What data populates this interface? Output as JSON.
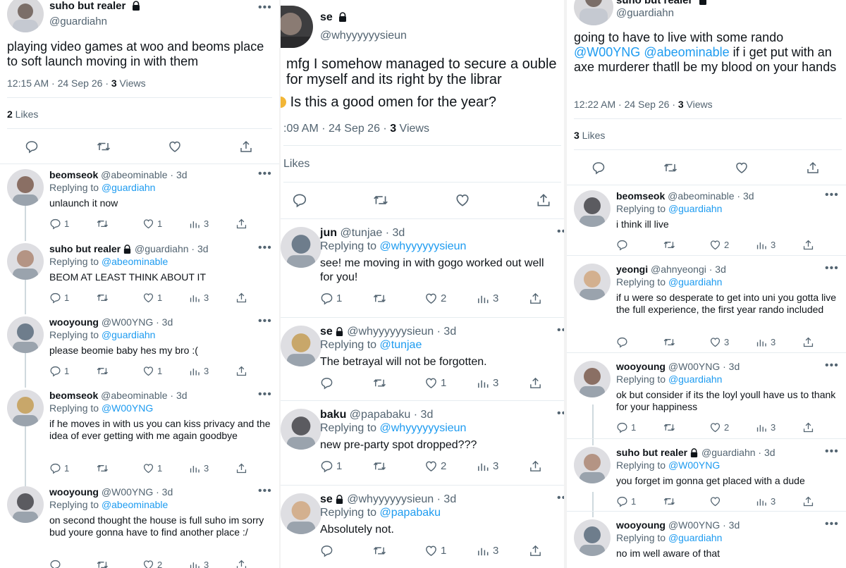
{
  "left": {
    "main": {
      "name": "suho but realer",
      "handle": "@guardiahn",
      "text": "playing video games at woo and beoms place to soft launch moving in with them",
      "time": "12:15 AM · 24 Sep 26 · ",
      "views_count": "3",
      "views_label": " Views",
      "likes_count": "2",
      "likes_label": " Likes"
    },
    "replies": [
      {
        "name": "beomseok",
        "meta": "@abeominable · 3d",
        "replying": "Replying to ",
        "to": "@guardiahn",
        "text": "unlaunch it now",
        "replies": "1",
        "likes": "1",
        "views": "3"
      },
      {
        "name": "suho but realer",
        "meta": "@guardiahn · 3d",
        "replying": "Replying to ",
        "to": "@abeominable",
        "text": "BEOM AT LEAST THINK ABOUT IT",
        "replies": "1",
        "likes": "1",
        "views": "3"
      },
      {
        "name": "wooyoung",
        "meta": "@W00YNG · 3d",
        "replying": "Replying to ",
        "to": "@guardiahn",
        "text": "please beomie baby hes my bro :(",
        "replies": "1",
        "likes": "1",
        "views": "3"
      },
      {
        "name": "beomseok",
        "meta": "@abeominable · 3d",
        "replying": "Replying to ",
        "to": "@W00YNG",
        "text": "if he moves in with us you can kiss privacy and the idea of ever getting with me again goodbye",
        "replies": "1",
        "likes": "1",
        "views": "3"
      },
      {
        "name": "wooyoung",
        "meta": "@W00YNG · 3d",
        "replying": "Replying to ",
        "to": "@abeominable",
        "text": "on second thought the house is full suho im sorry bud youre gonna have to find another place :/",
        "replies": "",
        "likes": "2",
        "views": "3"
      }
    ]
  },
  "middle": {
    "main": {
      "name": "se",
      "handle": "@whyyyyyysieun",
      "text": "mfg I somehow managed to secure a ouble for myself and its right by the librar",
      "text2": "Is this a good omen for the year?",
      "time": ":09 AM · 24 Sep 26 · ",
      "views_count": "3",
      "views_label": " Views",
      "likes_label": "Likes"
    },
    "replies": [
      {
        "name": "jun",
        "meta": "@tunjae · 3d",
        "replying": "Replying to ",
        "to": "@whyyyyyysieun",
        "text": "see! me moving in with gogo worked out well for you!",
        "replies": "1",
        "likes": "2",
        "views": "3"
      },
      {
        "name": "se",
        "meta": "@whyyyyyysieun · 3d",
        "replying": "Replying to ",
        "to": "@tunjae",
        "text": "The betrayal will not be forgotten.",
        "replies": "",
        "likes": "1",
        "views": "3"
      },
      {
        "name": "baku",
        "meta": "@papabaku · 3d",
        "replying": "Replying to ",
        "to": "@whyyyyyysieun",
        "text": "new pre-party spot dropped???",
        "replies": "1",
        "likes": "2",
        "views": "3"
      },
      {
        "name": "se",
        "meta": "@whyyyyyysieun · 3d",
        "replying": "Replying to ",
        "to": "@papabaku",
        "text": "Absolutely not.",
        "replies": "",
        "likes": "1",
        "views": "3"
      }
    ]
  },
  "right": {
    "main": {
      "name": "suho but realer",
      "handle": "@guardiahn",
      "text_a": "going to have to live with some rando ",
      "mention1": "@W00YNG",
      "mention2": "@abeominable",
      "text_b": " if i get put with an axe murderer thatll be my blood on your hands",
      "time": "12:22 AM · 24 Sep 26 · ",
      "views_count": "3",
      "views_label": " Views",
      "likes_count": "3",
      "likes_label": " Likes"
    },
    "replies": [
      {
        "name": "beomseok",
        "meta": "@abeominable · 3d",
        "replying": "Replying to ",
        "to": "@guardiahn",
        "text": "i think ill live",
        "replies": "",
        "likes": "2",
        "views": "3"
      },
      {
        "name": "yeongi",
        "meta": "@ahnyeongi · 3d",
        "replying": "Replying to ",
        "to": "@guardiahn",
        "text": "if u were so desperate to get into uni you gotta live the full experience, the first year rando included",
        "replies": "",
        "likes": "3",
        "views": "3"
      },
      {
        "name": "wooyoung",
        "meta": "@W00YNG · 3d",
        "replying": "Replying to ",
        "to": "@guardiahn",
        "text": "ok but consider if its the loyl youll have us to thank for your happiness",
        "replies": "1",
        "likes": "2",
        "views": "3"
      },
      {
        "name": "suho but realer",
        "meta": "@guardiahn · 3d",
        "replying": "Replying to ",
        "to": "@W00YNG",
        "text": "you forget im gonna get placed with a dude",
        "replies": "1",
        "likes": "",
        "views": "3"
      },
      {
        "name": "wooyoung",
        "meta": "@W00YNG · 3d",
        "replying": "Replying to ",
        "to": "@guardiahn",
        "text": "no im well aware of that",
        "replies": "",
        "likes": "",
        "views": ""
      }
    ]
  }
}
